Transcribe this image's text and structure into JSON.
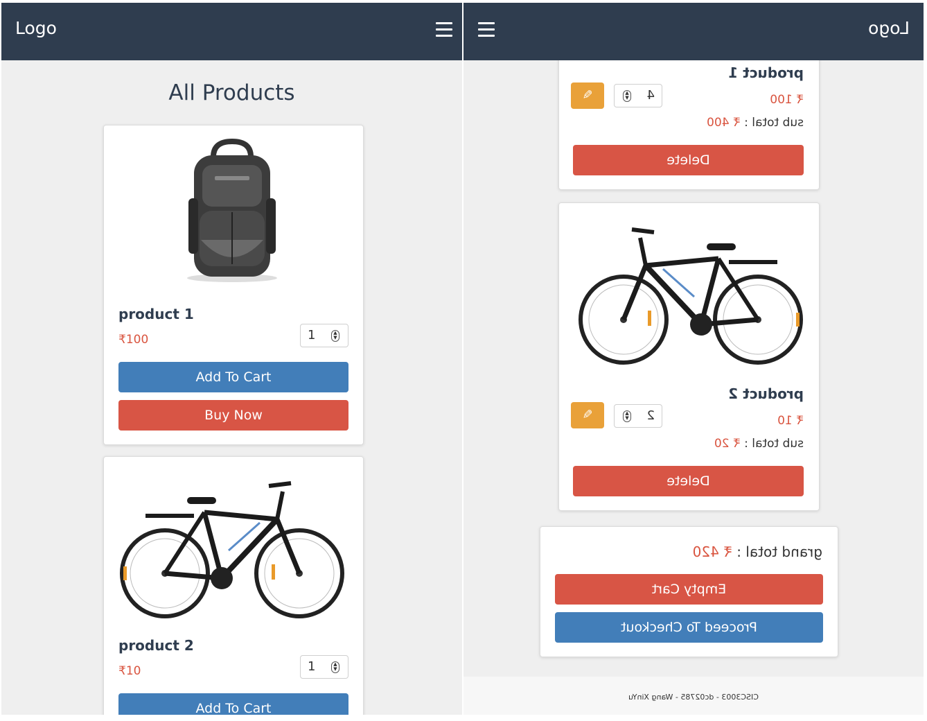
{
  "left_pane": {
    "navbar": {
      "logo": "Logo",
      "menu_icon": "hamburger-menu-icon"
    },
    "page_title": "All Products",
    "products": [
      {
        "name": "product 1",
        "price": "₹100",
        "quantity": "1",
        "add_to_cart": "Add To Cart",
        "buy_now": "Buy Now",
        "image": "backpack"
      },
      {
        "name": "product 2",
        "price": "₹10",
        "quantity": "1",
        "add_to_cart": "Add To Cart",
        "image": "bicycle"
      }
    ]
  },
  "right_pane": {
    "navbar": {
      "logo": "Logo",
      "menu_icon": "hamburger-menu-icon"
    },
    "cart_items": [
      {
        "name": "product 1",
        "price": "₹ 100",
        "quantity": "4",
        "subtotal_label": "sub total :",
        "subtotal_value": "₹ 400",
        "delete": "Delete",
        "update_icon": "edit-icon"
      },
      {
        "name": "product 2",
        "price": "₹ 10",
        "quantity": "2",
        "subtotal_label": "sub total :",
        "subtotal_value": "₹ 20",
        "delete": "Delete",
        "update_icon": "edit-icon",
        "image": "bicycle"
      }
    ],
    "summary": {
      "grand_total_label": "grand total :",
      "grand_total_value": "₹ 420",
      "empty_cart": "Empty Cart",
      "checkout": "Proceed To Checkout"
    },
    "footer": "CISC3003 - dc02785 - Wang XinYu"
  },
  "colors": {
    "navbar": "#2f3d4f",
    "primary": "#427eb9",
    "danger": "#d85545",
    "warning": "#e9a139",
    "price": "#d9543f"
  }
}
